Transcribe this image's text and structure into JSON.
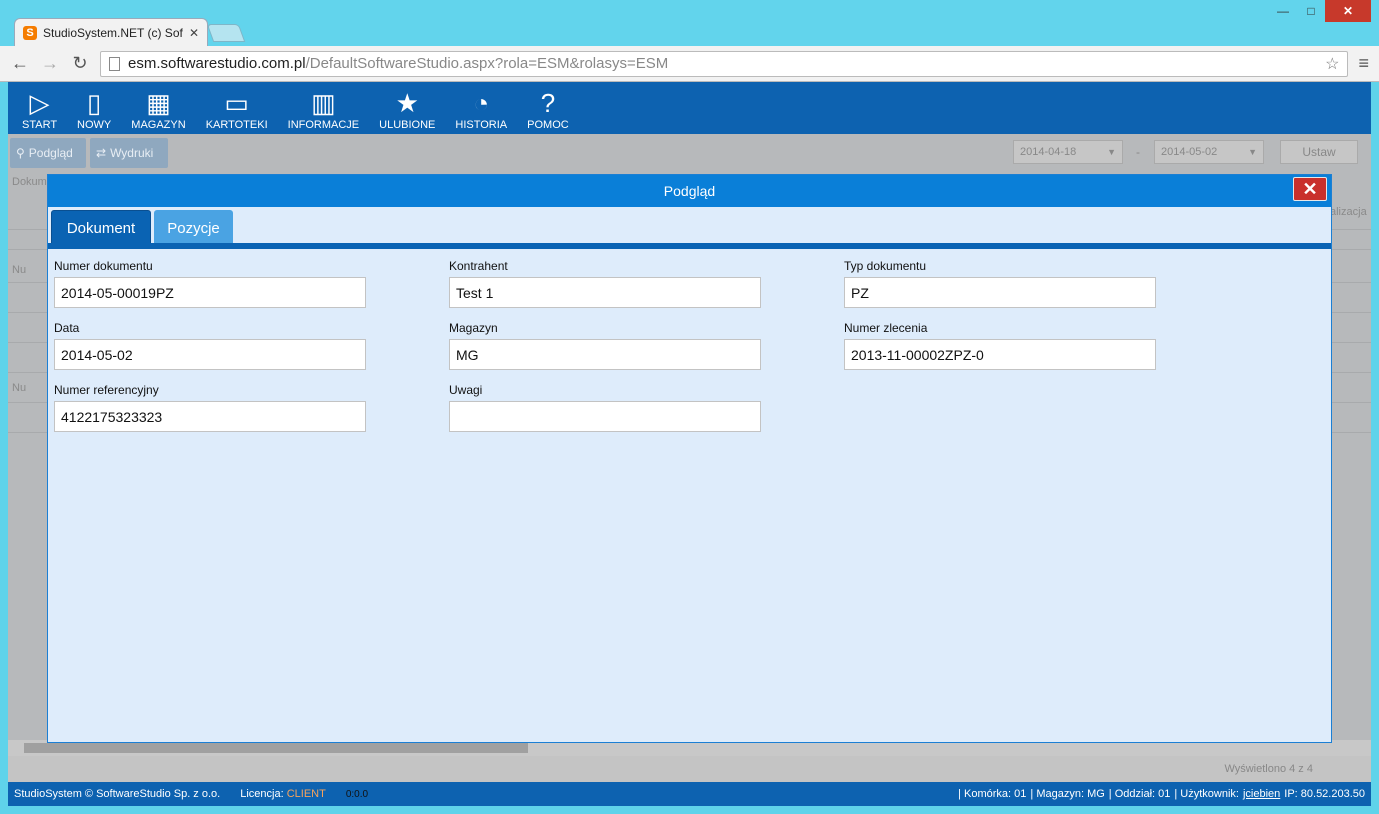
{
  "browser": {
    "tab_title": "StudioSystem.NET (c) Soft",
    "tab_favicon": "S",
    "url_host": "esm.softwarestudio.com.pl",
    "url_path": "/DefaultSoftwareStudio.aspx?rola=ESM&rolasys=ESM"
  },
  "toolbar": {
    "items": [
      {
        "label": "START",
        "icon": "play-icon"
      },
      {
        "label": "NOWY",
        "icon": "new-document-icon"
      },
      {
        "label": "MAGAZYN",
        "icon": "warehouse-grid-icon"
      },
      {
        "label": "KARTOTEKI",
        "icon": "window-icon"
      },
      {
        "label": "INFORMACJE",
        "icon": "bar-chart-icon"
      },
      {
        "label": "ULUBIONE",
        "icon": "star-icon"
      },
      {
        "label": "HISTORIA",
        "icon": "history-icon"
      },
      {
        "label": "POMOC",
        "icon": "help-icon"
      }
    ]
  },
  "subtoolbar": {
    "preview_label": "Podgląd",
    "prints_label": "Wydruki",
    "date_from": "2014-04-18",
    "date_to": "2014-05-02",
    "separator": "-",
    "set_label": "Ustaw"
  },
  "background_grid": {
    "header_text": "Dokum",
    "right_header": "alizacja",
    "group1": "Nu",
    "group2": "Nu",
    "footer": "Wyświetlono 4 z 4"
  },
  "modal": {
    "title": "Podgląd",
    "tabs": [
      {
        "label": "Dokument"
      },
      {
        "label": "Pozycje"
      }
    ],
    "fields": {
      "numer_dokumentu": {
        "label": "Numer dokumentu",
        "value": "2014-05-00019PZ"
      },
      "kontrahent": {
        "label": "Kontrahent",
        "value": "Test 1"
      },
      "typ_dokumentu": {
        "label": "Typ dokumentu",
        "value": "PZ"
      },
      "data": {
        "label": "Data",
        "value": "2014-05-02"
      },
      "magazyn": {
        "label": "Magazyn",
        "value": "MG"
      },
      "numer_zlecenia": {
        "label": "Numer zlecenia",
        "value": "2013-11-00002ZPZ-0"
      },
      "numer_referencyjny": {
        "label": "Numer referencyjny",
        "value": "4122175323323"
      },
      "uwagi": {
        "label": "Uwagi",
        "value": ""
      }
    }
  },
  "statusbar": {
    "copyright": "StudioSystem © SoftwareStudio Sp. z o.o.",
    "license_label": "Licencja:",
    "license_value": "CLIENT",
    "time": "0:0.0",
    "komorka": "| Komórka: 01",
    "magazyn": "| Magazyn: MG",
    "oddzial": "| Oddział: 01",
    "uzytkownik_label": "| Użytkownik:",
    "uzytkownik": "jciebien",
    "ip": "IP: 80.52.203.50"
  }
}
